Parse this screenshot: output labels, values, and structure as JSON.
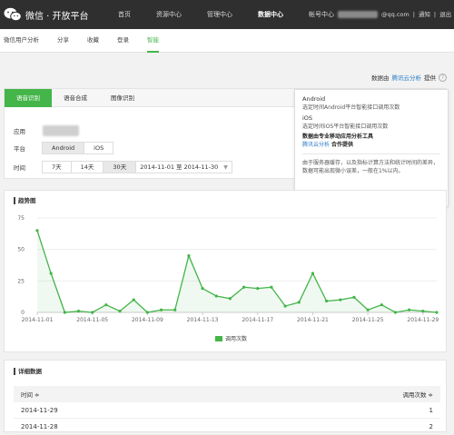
{
  "app": {
    "title": "微信 · 开放平台"
  },
  "nav": [
    {
      "label": "首页",
      "active": false
    },
    {
      "label": "资源中心",
      "active": false
    },
    {
      "label": "管理中心",
      "active": false
    },
    {
      "label": "数据中心",
      "active": true
    },
    {
      "label": "帐号中心",
      "active": false
    }
  ],
  "account": {
    "email_suffix": "@qq.com",
    "sep": "|",
    "notice": "通知",
    "logout": "退出"
  },
  "subnav": [
    {
      "label": "微信用户分析",
      "active": false
    },
    {
      "label": "分享",
      "active": false
    },
    {
      "label": "收藏",
      "active": false
    },
    {
      "label": "登录",
      "active": false
    },
    {
      "label": "智能",
      "active": true
    }
  ],
  "datasource": {
    "prefix": "数据由",
    "link": "腾讯云分析",
    "suffix": "提供"
  },
  "tabs": [
    {
      "label": "语音识别",
      "active": true
    },
    {
      "label": "语音合成",
      "active": false
    },
    {
      "label": "图像识别",
      "active": false
    }
  ],
  "filters": {
    "app_label": "应用",
    "platform_label": "平台",
    "platform_options": [
      "Android",
      "iOS"
    ],
    "time_label": "时间",
    "time_options": [
      "7天",
      "14天",
      "30天"
    ],
    "date_start": "2014-11-01",
    "date_sep": "至",
    "date_end": "2014-11-30"
  },
  "tooltip": {
    "android_title": "Android",
    "android_desc": "选定时间Android平台智能接口调用次数",
    "ios_title": "iOS",
    "ios_desc": "选定时间iOS平台智能接口调用次数",
    "tool_line": "数据由专业移动应用分析工具",
    "tool_link": "腾讯云分析",
    "tool_suffix": "合作提供",
    "note": "由于服务器缓存，以及指标计算方法和统计时间的差异，数据可能出现微小误差，一般在1%以内。"
  },
  "trend": {
    "title": "趋势图",
    "legend": "调用次数"
  },
  "chart_data": {
    "type": "line",
    "title": "趋势图",
    "x": [
      "2014-11-01",
      "2014-11-02",
      "2014-11-03",
      "2014-11-04",
      "2014-11-05",
      "2014-11-06",
      "2014-11-07",
      "2014-11-08",
      "2014-11-09",
      "2014-11-10",
      "2014-11-11",
      "2014-11-12",
      "2014-11-13",
      "2014-11-14",
      "2014-11-15",
      "2014-11-16",
      "2014-11-17",
      "2014-11-18",
      "2014-11-19",
      "2014-11-20",
      "2014-11-21",
      "2014-11-22",
      "2014-11-23",
      "2014-11-24",
      "2014-11-25",
      "2014-11-26",
      "2014-11-27",
      "2014-11-28",
      "2014-11-29",
      "2014-11-30"
    ],
    "series": [
      {
        "name": "调用次数",
        "values": [
          65,
          31,
          0,
          1,
          0,
          6,
          1,
          10,
          0,
          2,
          2,
          45,
          19,
          13,
          11,
          20,
          19,
          20,
          5,
          8,
          31,
          9,
          10,
          12,
          2,
          6,
          0,
          2,
          1,
          0
        ]
      }
    ],
    "xticks": [
      "2014-11-01",
      "2014-11-05",
      "2014-11-09",
      "2014-11-13",
      "2014-11-17",
      "2014-11-21",
      "2014-11-25",
      "2014-11-29"
    ],
    "yticks": [
      0,
      25,
      50,
      75
    ],
    "ylim": [
      0,
      75
    ],
    "color": "#44b549",
    "legend": "bottom-center",
    "grid": true
  },
  "detail": {
    "title": "详细数据",
    "col_time": "时间 ≑",
    "col_count": "调用次数 ≑",
    "rows": [
      {
        "date": "2014-11-29",
        "count": "1"
      },
      {
        "date": "2014-11-28",
        "count": "2"
      }
    ]
  }
}
